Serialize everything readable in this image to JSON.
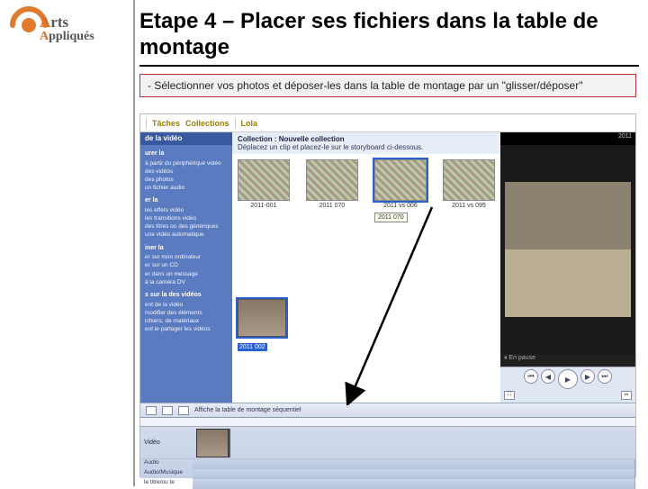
{
  "logo": {
    "line1a": "A",
    "line1b": "rts",
    "line2a": "A",
    "line2b": "ppliqués"
  },
  "heading": "Etape 4 – Placer ses fichiers dans la table de montage",
  "instruction": "- Sélectionner vos photos et déposer-les dans la table de montage par un \"glisser/déposer\"",
  "toolbar": {
    "item1": "Tâches",
    "item2": "Collections",
    "item3": "Lola"
  },
  "taskpane": {
    "head": "de la vidéo",
    "sec1": "urer la",
    "items1": [
      "à partir du périphérique vidéo",
      "des vidéos",
      "des photos",
      "un fichier audio"
    ],
    "sec2": "er la",
    "items2": [
      "les effets vidéo",
      "les transitions vidéo",
      "des titres ou des génériques",
      "une vidéo automatique"
    ],
    "sec3": "iner la",
    "items3": [
      "er sur mon ordinateur",
      "er sur un CD",
      "er dans un message",
      "à la caméra DV"
    ],
    "sec4": "s sur la des vidéos",
    "items4": [
      "ent de la vidéo",
      "modifier des éléments",
      "ichiers, de matériaux",
      "ent le partager les vidéos"
    ]
  },
  "center": {
    "title": "Collection : Nouvelle collection",
    "sub": "Déplacez un clip et placez-le sur le storyboard ci-dessous.",
    "thumbs": [
      {
        "label": "2011-001"
      },
      {
        "label": "2011 070"
      },
      {
        "label": "2011 vs 006",
        "tooltip": "2011 070"
      },
      {
        "label": "2011 vs 095"
      }
    ],
    "selected_label": "2011 002"
  },
  "preview": {
    "top": "2011",
    "footer": "En pause"
  },
  "timeline": {
    "topbar_text": "Affiche la table de montage séquentiel",
    "track1": "Vidéo",
    "track2": "Audio",
    "track3": "Audio/Musique",
    "track4": "le titre/ou te"
  }
}
